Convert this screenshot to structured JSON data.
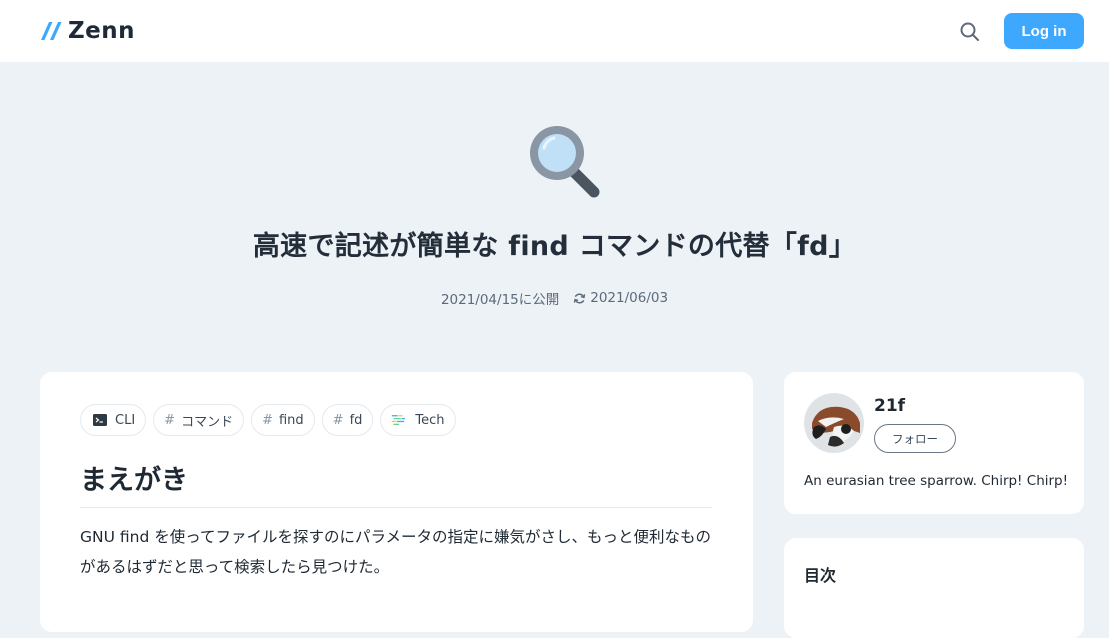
{
  "header": {
    "logo_text": "Zenn",
    "login_label": "Log in",
    "search_icon": "search-icon"
  },
  "article": {
    "emoji": "magnifying-glass-icon",
    "title": "高速で記述が簡単な find コマンドの代替「fd」",
    "published": "2021/04/15に公開",
    "updated": "2021/06/03",
    "topics": [
      {
        "label": "CLI",
        "icon": "terminal-icon"
      },
      {
        "label": "コマンド",
        "icon": "hash"
      },
      {
        "label": "find",
        "icon": "hash"
      },
      {
        "label": "fd",
        "icon": "hash"
      },
      {
        "label": "Tech",
        "icon": "tech-icon"
      }
    ],
    "heading": "まえがき",
    "paragraph": "GNU find を使ってファイルを探すのにパラメータの指定に嫌気がさし、もっと便利なものがあるはずだと思って検索したら見つけた。"
  },
  "author": {
    "name": "21f",
    "follow_label": "フォロー",
    "bio": "An eurasian tree sparrow. Chirp! Chirp!"
  },
  "toc": {
    "title": "目次"
  },
  "colors": {
    "accent": "#3ea8ff",
    "background": "#edf2f7"
  }
}
